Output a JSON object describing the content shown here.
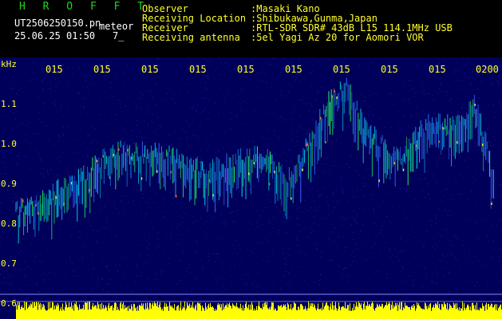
{
  "header": {
    "title": "H R O F F T",
    "filename": "UT2506250150.pn",
    "event_type": "meteor",
    "datetime": "25.06.25 01:50",
    "count": "7_",
    "info": [
      {
        "label": "Observer",
        "value": ":Masaki Kano"
      },
      {
        "label": "Receiving Location",
        "value": ":Shibukawa,Gunma,Japan"
      },
      {
        "label": "Receiver",
        "value": ":RTL-SDR SDR# 43dB L15 114.1MHz USB"
      },
      {
        "label": "Receiving antenna",
        "value": ":5el Yagi Az 20 for Aomori VOR"
      }
    ]
  },
  "spectrogram": {
    "y_unit": "kHz",
    "y_ticks": [
      "1.1",
      "1.0",
      "0.9",
      "0.8",
      "0.7",
      "0.6"
    ],
    "time_ticks": [
      "015",
      "015",
      "015",
      "015",
      "015",
      "015",
      "015",
      "015",
      "015",
      "0200"
    ],
    "colors": {
      "background": "#00005a",
      "label": "#ffff2b",
      "baseline": "#ffff00",
      "title": "#22d41e"
    }
  }
}
